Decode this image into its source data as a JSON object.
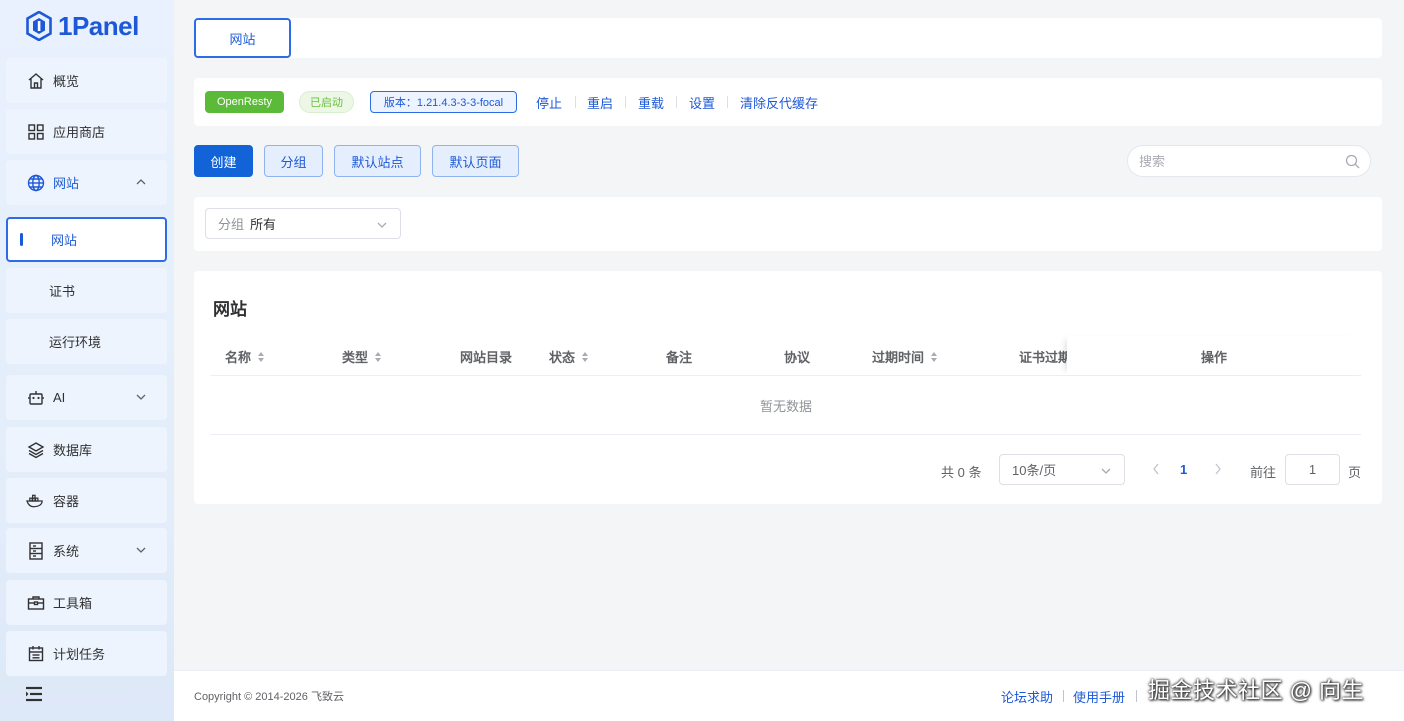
{
  "brand": {
    "name": "1Panel"
  },
  "sidebar": {
    "items": [
      {
        "label": "概览",
        "icon": "home-icon"
      },
      {
        "label": "应用商店",
        "icon": "apps-grid-icon"
      },
      {
        "label": "网站",
        "icon": "globe-icon",
        "expanded": true
      },
      {
        "label": "网站",
        "active": true
      },
      {
        "label": "证书"
      },
      {
        "label": "运行环境"
      },
      {
        "label": "AI",
        "icon": "robot-icon"
      },
      {
        "label": "数据库",
        "icon": "layers-icon"
      },
      {
        "label": "容器",
        "icon": "docker-icon"
      },
      {
        "label": "系统",
        "icon": "server-icon"
      },
      {
        "label": "工具箱",
        "icon": "toolbox-icon"
      },
      {
        "label": "计划任务",
        "icon": "calendar-icon"
      }
    ]
  },
  "tabs": {
    "active": "网站"
  },
  "app_bar": {
    "app_name": "OpenResty",
    "status": "已启动",
    "version": "版本：1.21.4.3-3-3-focal",
    "actions": [
      "停止",
      "重启",
      "重载",
      "设置",
      "清除反代缓存"
    ]
  },
  "toolbar": {
    "create": "创建",
    "group": "分组",
    "default_site": "默认站点",
    "default_page": "默认页面",
    "search_placeholder": "搜索"
  },
  "filter": {
    "prefix": "分组",
    "value": "所有"
  },
  "table": {
    "title": "网站",
    "columns": [
      "名称",
      "类型",
      "网站目录",
      "状态",
      "备注",
      "协议",
      "过期时间",
      "证书过期",
      "操作"
    ],
    "empty_text": "暂无数据"
  },
  "pagination": {
    "total": "共 0 条",
    "page_size": "10条/页",
    "current_page": "1",
    "goto_label": "前往",
    "goto_value": "1",
    "page_suffix": "页"
  },
  "footer": {
    "copyright": "Copyright © 2014-2026 飞致云",
    "links": [
      "论坛求助",
      "使用手册"
    ]
  },
  "watermark": "掘金技术社区 @ 向生",
  "colors": {
    "primary": "#1d59d7",
    "success": "#5bbb39",
    "sidebar_bg": "#e6effc"
  }
}
